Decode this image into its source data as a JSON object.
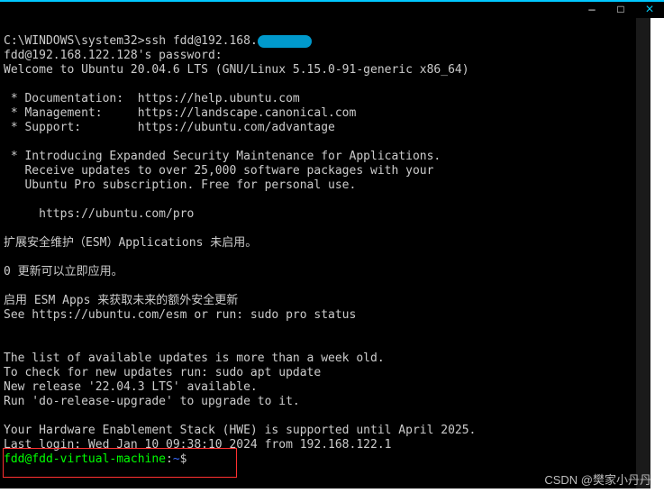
{
  "window": {
    "min": "—",
    "max": "□",
    "close": "×"
  },
  "redacted_ip_prefix": "ssh fdd@192.168.",
  "term": {
    "l1a": "C:\\WINDOWS\\system32>",
    "l2": "fdd@192.168.122.128's password:",
    "l3": "Welcome to Ubuntu 20.04.6 LTS (GNU/Linux 5.15.0-91-generic x86_64)",
    "l4": "",
    "l5": " * Documentation:  https://help.ubuntu.com",
    "l6": " * Management:     https://landscape.canonical.com",
    "l7": " * Support:        https://ubuntu.com/advantage",
    "l8": "",
    "l9": " * Introducing Expanded Security Maintenance for Applications.",
    "l10": "   Receive updates to over 25,000 software packages with your",
    "l11": "   Ubuntu Pro subscription. Free for personal use.",
    "l12": "",
    "l13": "     https://ubuntu.com/pro",
    "l14": "",
    "l15": "扩展安全维护（ESM）Applications 未启用。",
    "l16": "",
    "l17": "0 更新可以立即应用。",
    "l18": "",
    "l19": "启用 ESM Apps 来获取未来的额外安全更新",
    "l20": "See https://ubuntu.com/esm or run: sudo pro status",
    "l21": "",
    "l22": "",
    "l23": "The list of available updates is more than a week old.",
    "l24": "To check for new updates run: sudo apt update",
    "l25": "New release '22.04.3 LTS' available.",
    "l26": "Run 'do-release-upgrade' to upgrade to it.",
    "l27": "",
    "l28": "Your Hardware Enablement Stack (HWE) is supported until April 2025.",
    "l29": "Last login: Wed Jan 10 09:38:10 2024 from 192.168.122.1",
    "prompt_user": "fdd@fdd-virtual-machine",
    "prompt_colon": ":",
    "prompt_path": "~",
    "prompt_dollar": "$ "
  },
  "watermark": "CSDN @樊家小丹丹"
}
